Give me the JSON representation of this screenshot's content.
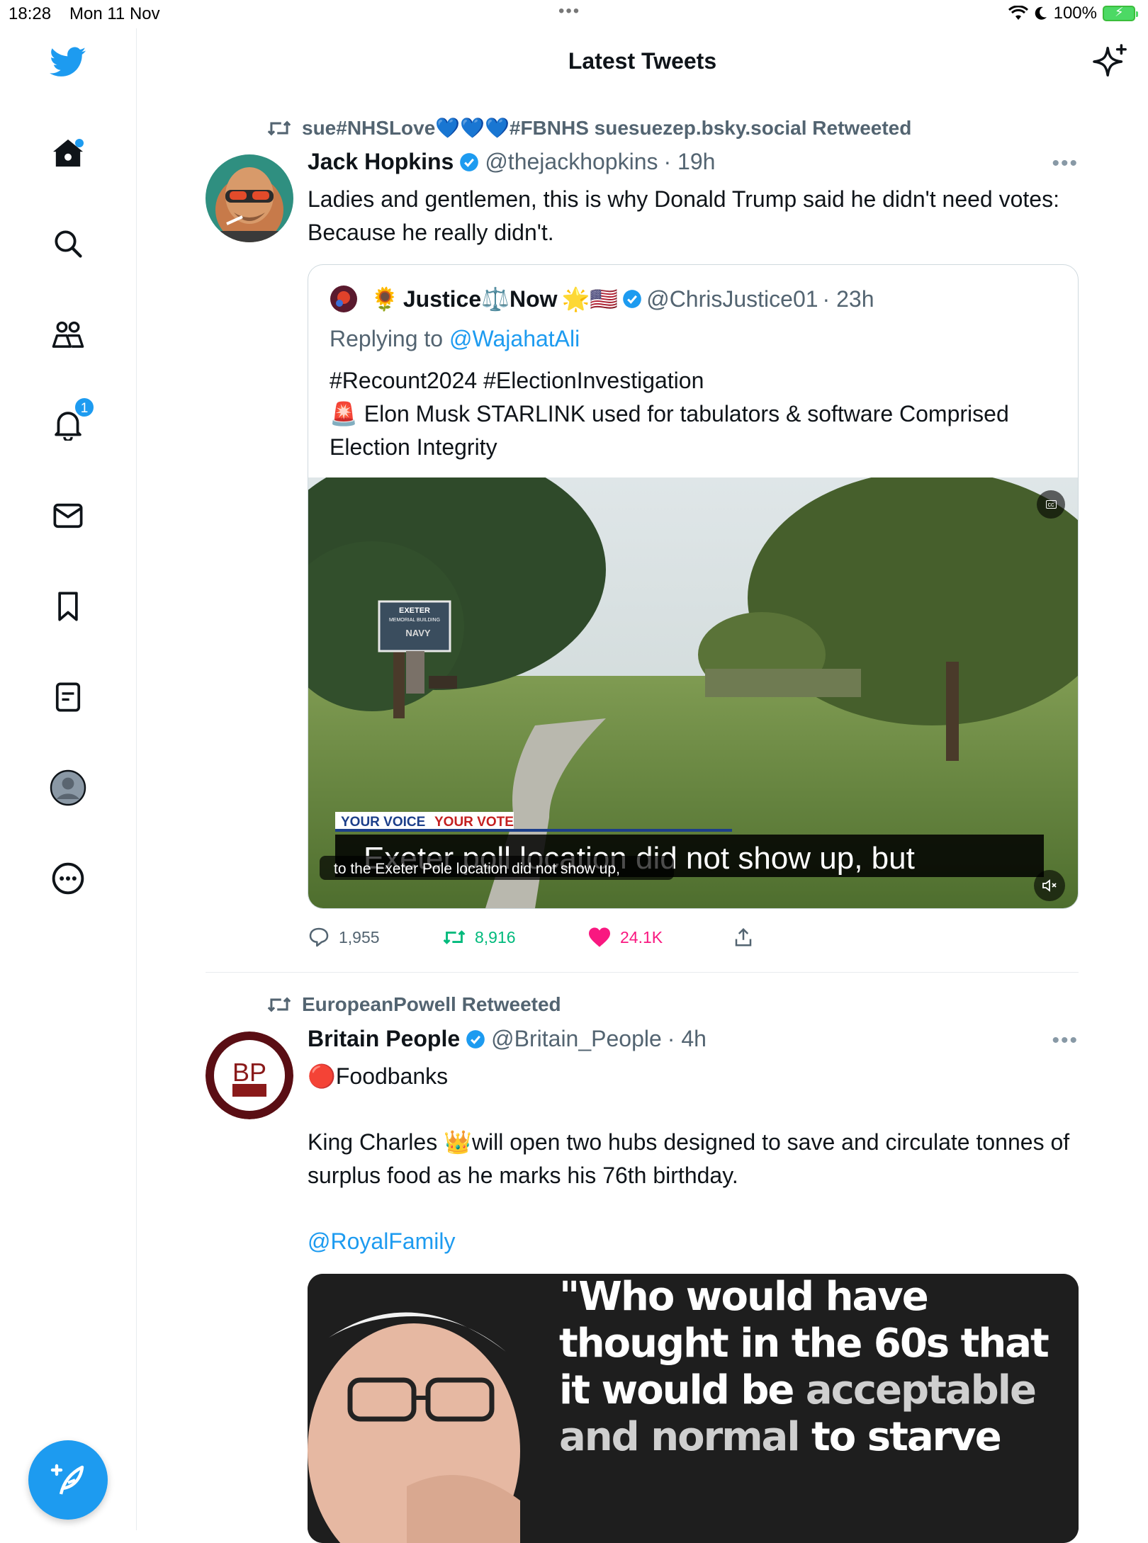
{
  "status": {
    "time": "18:28",
    "date": "Mon 11 Nov",
    "battery": "100%"
  },
  "header": {
    "title": "Latest Tweets"
  },
  "nav": {
    "notifications_badge": "1"
  },
  "tweets": [
    {
      "retweeted_by": "sue#NHSLove💙💙💙#FBNHS suesuezep.bsky.social Retweeted",
      "name": "Jack Hopkins",
      "handle": "@thejackhopkins",
      "time": "· 19h",
      "text": "Ladies and gentlemen, this is why Donald Trump said he didn't need votes: Because he really didn't.",
      "quote": {
        "name_prefix": "🌻",
        "name": "Justice⚖️Now",
        "name_suffix": "🌟🇺🇸",
        "handle": "@ChrisJustice01",
        "time": "· 23h",
        "replying_label": "Replying to",
        "replying_handle": "@WajahatAli",
        "text_line1": "#Recount2024 #ElectionInvestigation",
        "text_line2": "🚨 Elon Musk STARLINK used for tabulators & software Comprised Election Integrity",
        "video": {
          "sign_line1": "EXETER",
          "sign_line2": "MEMORIAL BUILDING",
          "sign_line3": "NAVY",
          "banner": "YOUR VOICE",
          "banner2": "YOUR VOTE",
          "caption_big": "Exeter poll location did not show up, but",
          "caption_small": "to the Exeter Pole location did not show up,",
          "cc": "cc"
        }
      },
      "replies": "1,955",
      "retweets": "8,916",
      "likes": "24.1K"
    },
    {
      "retweeted_by": "EuropeanPowell Retweeted",
      "name": "Britain People",
      "handle": "@Britain_People",
      "time": "· 4h",
      "avatar_text": "BP",
      "text_line1": "🔴Foodbanks",
      "text_line2": "King Charles 👑will open two hubs designed to save and circulate tonnes of surplus food as he marks his 76th birthday.",
      "mention": "@RoyalFamily",
      "image_quote": {
        "q1": "\"Who would have",
        "q2": "thought in the 60s that",
        "q3a": "it would be ",
        "q3b": "acceptable",
        "q4a": "and normal",
        "q4b": " to starve"
      }
    }
  ],
  "colors": {
    "accent": "#1d9bf0",
    "retweet_green": "#00ba7c",
    "like_pink": "#f91880",
    "secondary": "#536471"
  }
}
